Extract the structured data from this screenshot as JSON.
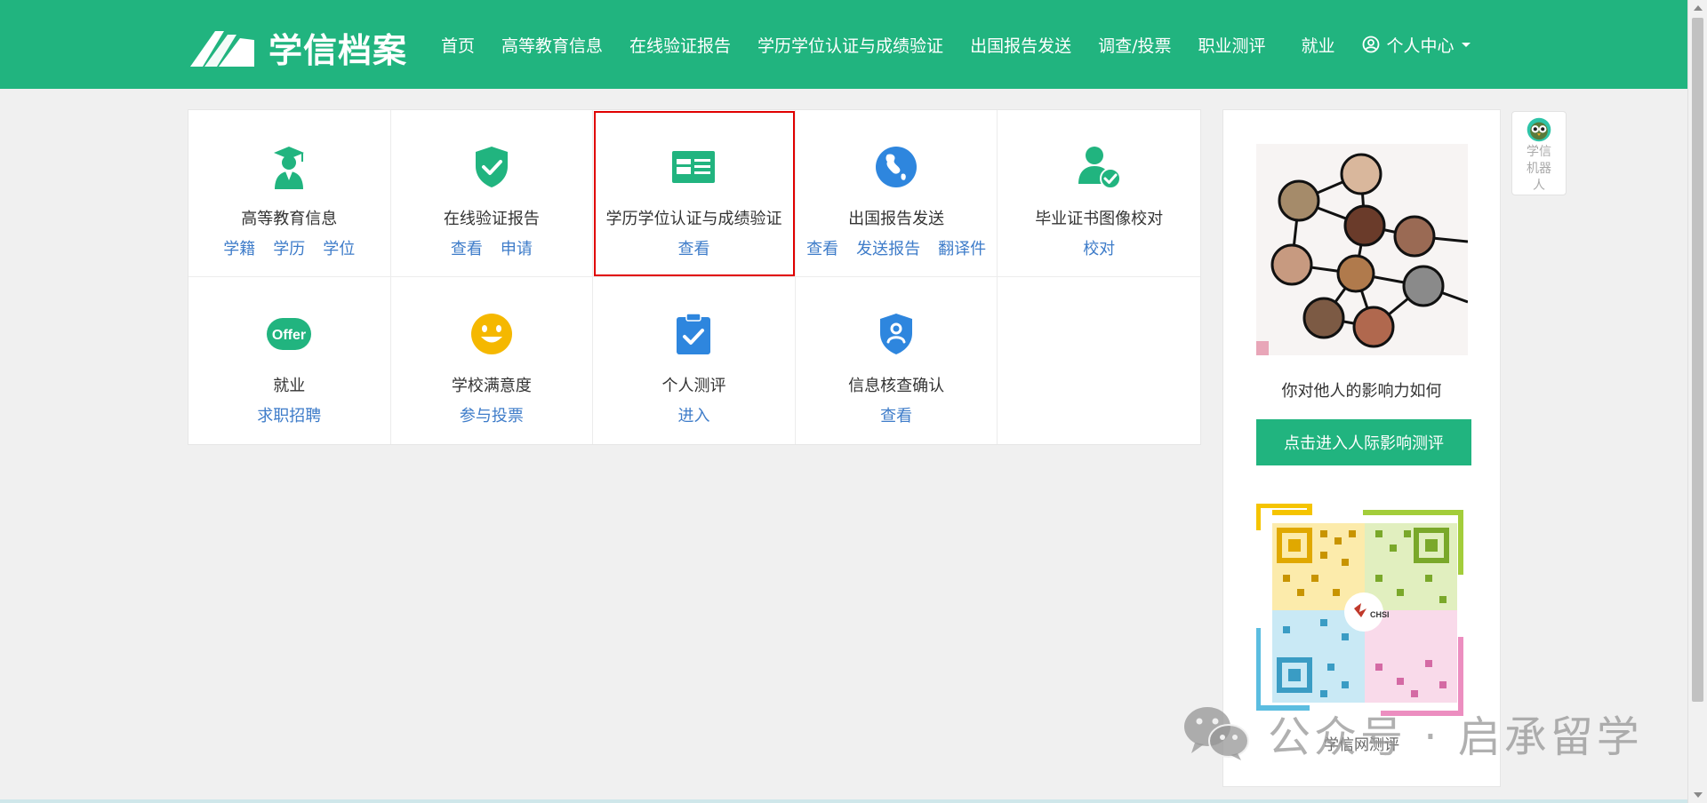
{
  "header": {
    "logo_text": "学信档案",
    "nav": [
      {
        "label": "首页"
      },
      {
        "label": "高等教育信息"
      },
      {
        "label": "在线验证报告"
      },
      {
        "label": "学历学位认证与成绩验证"
      },
      {
        "label": "出国报告发送"
      },
      {
        "label": "调查/投票"
      },
      {
        "label": "职业测评"
      },
      {
        "label": "就业"
      }
    ],
    "user_menu": "个人中心",
    "brand_color": "#21b47f"
  },
  "services": [
    {
      "title": "高等教育信息",
      "links": [
        "学籍",
        "学历",
        "学位"
      ],
      "icon": "graduate-icon"
    },
    {
      "title": "在线验证报告",
      "links": [
        "查看",
        "申请"
      ],
      "icon": "shield-check-icon"
    },
    {
      "title": "学历学位认证与成绩验证",
      "links": [
        "查看"
      ],
      "icon": "id-card-icon"
    },
    {
      "title": "出国报告发送",
      "links": [
        "查看",
        "发送报告",
        "翻译件"
      ],
      "icon": "globe-icon"
    },
    {
      "title": "毕业证书图像校对",
      "links": [
        "校对"
      ],
      "icon": "user-check-icon"
    },
    {
      "title": "就业",
      "links": [
        "求职招聘"
      ],
      "icon": "offer-icon"
    },
    {
      "title": "学校满意度",
      "links": [
        "参与投票"
      ],
      "icon": "smiley-icon"
    },
    {
      "title": "个人测评",
      "links": [
        "进入"
      ],
      "icon": "clipboard-check-icon"
    },
    {
      "title": "信息核查确认",
      "links": [
        "查看"
      ],
      "icon": "shield-user-icon"
    }
  ],
  "side_panel": {
    "caption": "你对他人的影响力如何",
    "cta": "点击进入人际影响测评",
    "qr_label": "学信网测评",
    "qr_center": "CHSI"
  },
  "robot": {
    "label": "学信机器人"
  },
  "watermark": {
    "text": "公众号 · 启承留学"
  },
  "colors": {
    "link": "#3e7cc9",
    "selected_outline": "#e00000",
    "icon_green": "#21b47f",
    "icon_blue": "#2e86de",
    "icon_yellow": "#f5b800"
  }
}
